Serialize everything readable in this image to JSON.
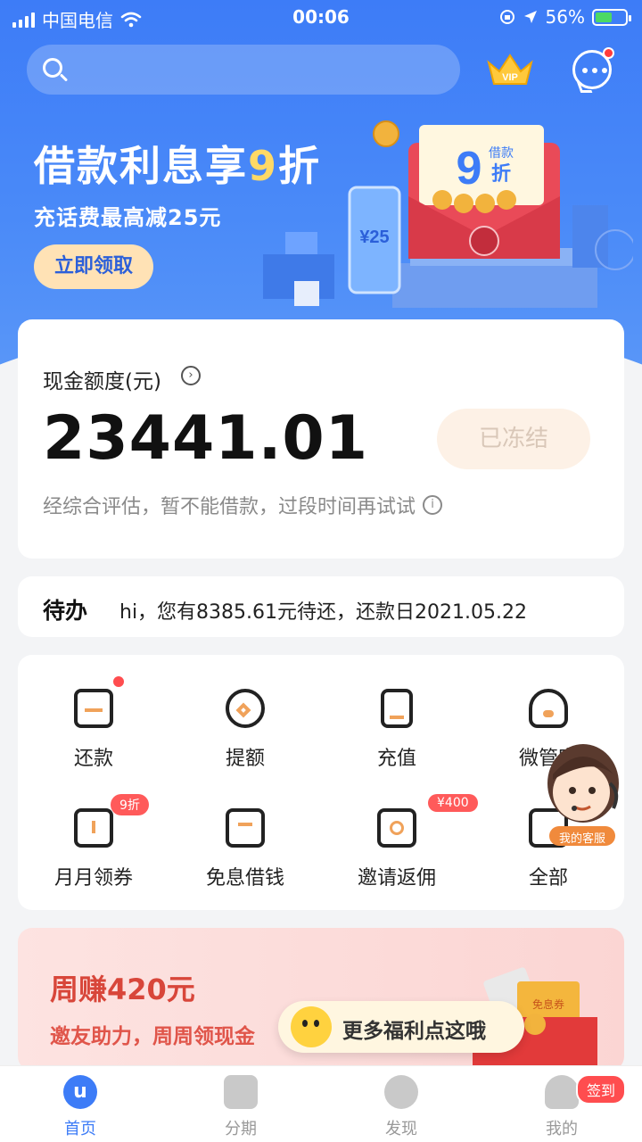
{
  "status_bar": {
    "carrier": "中国电信",
    "time": "00:06",
    "battery": "56%",
    "battery_level": 0.56
  },
  "header": {
    "search_placeholder": ""
  },
  "banner": {
    "title_prefix": "借款利息享",
    "title_highlight": "9",
    "title_suffix": "折",
    "subtitle": "充话费最高减25元",
    "button": "立即领取",
    "phone_label": "¥25",
    "envelope_big": "9",
    "envelope_small_top": "借款",
    "envelope_small_bottom": "折"
  },
  "quota": {
    "label": "现金额度(元)",
    "amount": "23441.01",
    "frozen_button": "已冻结",
    "hint": "经综合评估，暂不能借款，过段时间再试试"
  },
  "todo": {
    "title": "待办",
    "message": "hi，您有8385.61元待还，还款日2021.05.22"
  },
  "grid": {
    "items": [
      {
        "label": "还款",
        "icon": "repay-icon"
      },
      {
        "label": "提额",
        "icon": "raise-limit-icon"
      },
      {
        "label": "充值",
        "icon": "phone-recharge-icon"
      },
      {
        "label": "微管家",
        "icon": "butler-icon"
      },
      {
        "label": "月月领券",
        "icon": "coupon-icon",
        "tag": "9折"
      },
      {
        "label": "免息借钱",
        "icon": "interest-free-icon"
      },
      {
        "label": "邀请返佣",
        "icon": "invite-icon",
        "tag": "¥400"
      },
      {
        "label": "全部",
        "icon": "all-icon"
      }
    ]
  },
  "service": {
    "label": "我的客服"
  },
  "promo": {
    "title": "周赚420元",
    "subtitle": "邀友助力，周周领现金",
    "coupon_label": "免息券"
  },
  "bubble": {
    "text": "更多福利点这哦"
  },
  "tabbar": {
    "tabs": [
      {
        "label": "首页",
        "active": true
      },
      {
        "label": "分期",
        "active": false
      },
      {
        "label": "发现",
        "active": false
      },
      {
        "label": "我的",
        "active": false
      }
    ],
    "checkin_badge": "签到"
  },
  "colors": {
    "primary": "#3d7cf7",
    "gold": "#ffd966",
    "red": "#ff4d4f"
  }
}
